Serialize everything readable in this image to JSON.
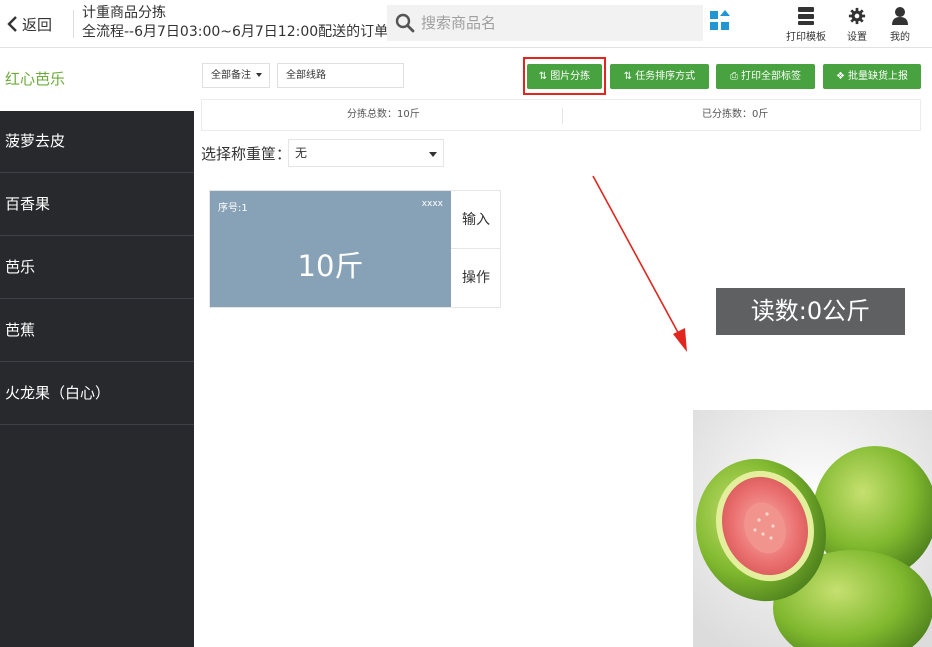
{
  "header": {
    "back_label": "返回",
    "title_line1": "计重商品分拣",
    "title_line2": "全流程--6月7日03:00~6月7日12:00配送的订单",
    "search_placeholder": "搜索商品名",
    "tools": [
      {
        "label": "打印模板",
        "icon": "server-icon"
      },
      {
        "label": "设置",
        "icon": "gear-icon"
      },
      {
        "label": "我的",
        "icon": "user-icon"
      }
    ]
  },
  "sidebar": {
    "items": [
      {
        "label": "红心芭乐",
        "active": true
      },
      {
        "label": "菠萝去皮",
        "active": false
      },
      {
        "label": "百香果",
        "active": false
      },
      {
        "label": "芭乐",
        "active": false
      },
      {
        "label": "芭蕉",
        "active": false
      },
      {
        "label": "火龙果（白心）",
        "active": false
      }
    ]
  },
  "toolbar": {
    "filter_remarks": "全部备注",
    "filter_routes": "全部线路",
    "buttons": [
      {
        "label": "图片分拣",
        "icon": "⇅"
      },
      {
        "label": "任务排序方式",
        "icon": "⇅"
      },
      {
        "label": "打印全部标签",
        "icon": "⎙"
      },
      {
        "label": "批量缺货上报",
        "icon": "❖"
      }
    ]
  },
  "totals": {
    "total_label": "分拣总数：10斤",
    "done_label": "已分拣数：0斤"
  },
  "scale": {
    "label": "选择称重筐：",
    "selected": "无"
  },
  "task_card": {
    "seq": "序号:1",
    "code": "xxxx",
    "weight": "10斤",
    "input_label": "输入",
    "action_label": "操作"
  },
  "reading": {
    "text": "读数:0公斤"
  },
  "colors": {
    "accent_green": "#48a23f",
    "sidebar_bg": "#27292d",
    "card_bg": "#87a2b6",
    "highlight_red": "#e0261e"
  }
}
